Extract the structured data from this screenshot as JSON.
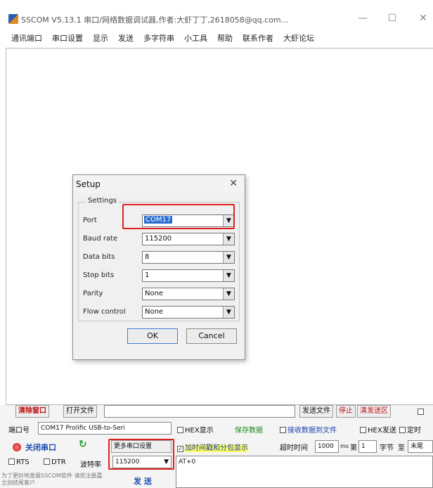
{
  "window": {
    "title": "SSCOM V5.13.1 串口/网络数据调试器,作者:大虾丁丁,2618058@qq.com...",
    "min": "—",
    "max": "☐",
    "close": "✕"
  },
  "menu": [
    "通讯端口",
    "串口设置",
    "显示",
    "发送",
    "多字符串",
    "小工具",
    "帮助",
    "联系作者",
    "大虾论坛"
  ],
  "dialog": {
    "title": "Setup",
    "close": "✕",
    "group": "Settings",
    "rows": [
      {
        "label": "Port",
        "value": "COM17"
      },
      {
        "label": "Baud rate",
        "value": "115200"
      },
      {
        "label": "Data bits",
        "value": "8"
      },
      {
        "label": "Stop bits",
        "value": "1"
      },
      {
        "label": "Parity",
        "value": "None"
      },
      {
        "label": "Flow control",
        "value": "None"
      }
    ],
    "ok": "OK",
    "cancel": "Cancel"
  },
  "bottom": {
    "clear_window": "清除窗口",
    "open_file": "打开文件",
    "send_file": "发送文件",
    "stop": "停止",
    "clear_send": "清发送区",
    "port_label": "端口号",
    "port_value": "COM17 Prolific USB-to-Seri",
    "hex_display": "HEX显示",
    "save_data": "保存数据",
    "recv_to_file": "接收数据到文件",
    "hex_send": "HEX发送",
    "timed": "定时",
    "close_port": "关闭串口",
    "more_settings": "更多串口设置",
    "timestamp": "加时间戳和分包显示",
    "timeout_label": "超时时间",
    "timeout_value": "1000",
    "ms": "ms",
    "nth_label": "第",
    "nth_value": "1",
    "byte_label": "字节",
    "to_label": "至",
    "end_label": "末尾",
    "rts": "RTS",
    "dtr": "DTR",
    "baud_label": "波特率",
    "baud_value": "115200",
    "send_text": "AT+0",
    "promo": "为了更好地发展SSCOM软件 请您注册嘉立创结尾客户",
    "send": "发 送"
  },
  "icons": [
    "app-icon",
    "dropdown-arrow-icon",
    "red-port-icon",
    "refresh-icon"
  ]
}
